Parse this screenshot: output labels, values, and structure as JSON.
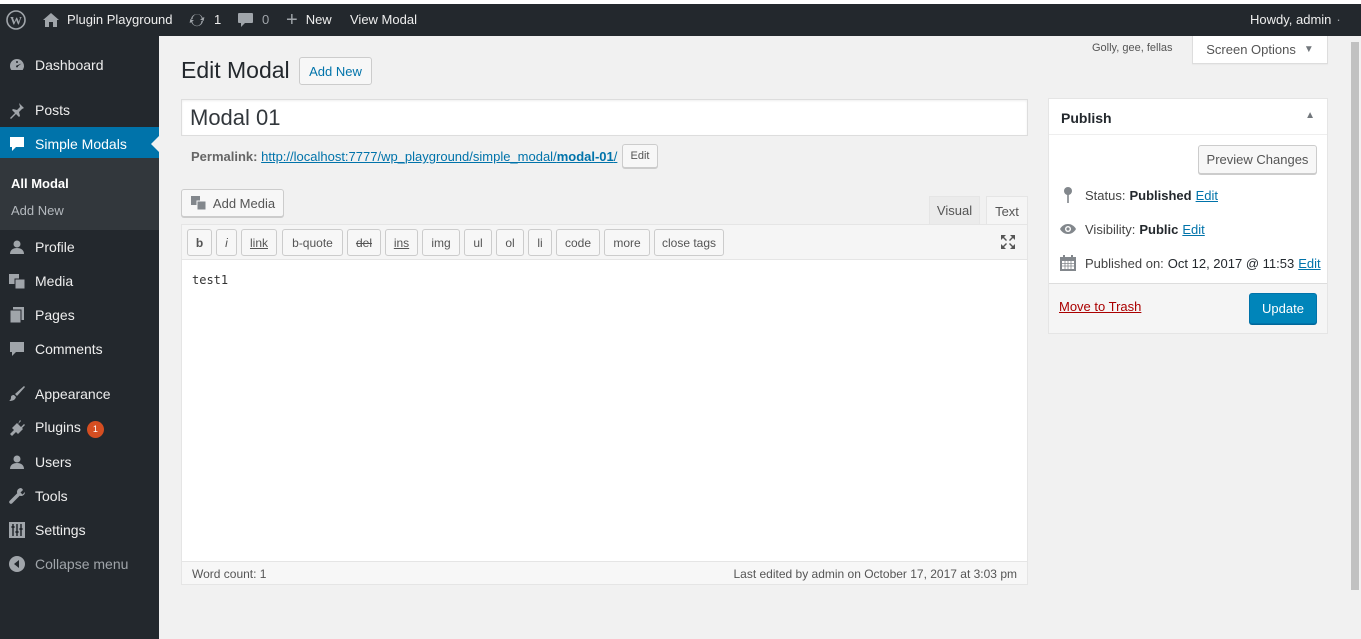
{
  "adminbar": {
    "site_name": "Plugin Playground",
    "updates_count": "1",
    "comments_count": "0",
    "new_label": "New",
    "view_label": "View Modal",
    "howdy": "Howdy, admin"
  },
  "sidebar": {
    "items": [
      {
        "label": "Dashboard"
      },
      {
        "label": "Posts"
      },
      {
        "label": "Simple Modals"
      },
      {
        "label": "Profile"
      },
      {
        "label": "Media"
      },
      {
        "label": "Pages"
      },
      {
        "label": "Comments"
      },
      {
        "label": "Appearance"
      },
      {
        "label": "Plugins",
        "badge": "1"
      },
      {
        "label": "Users"
      },
      {
        "label": "Tools"
      },
      {
        "label": "Settings"
      },
      {
        "label": "Collapse menu"
      }
    ],
    "submenu": [
      {
        "label": "All Modal"
      },
      {
        "label": "Add New"
      }
    ]
  },
  "header": {
    "hello_dolly": "Golly, gee, fellas",
    "screen_options": "Screen Options",
    "title": "Edit Modal",
    "add_new": "Add New"
  },
  "post": {
    "title": "Modal 01",
    "permalink_label": "Permalink:",
    "permalink_base": "http://localhost:7777/wp_playground/simple_modal/",
    "permalink_slug": "modal-01",
    "permalink_end": "/",
    "edit_slug": "Edit",
    "content": "test1"
  },
  "editor": {
    "add_media": "Add Media",
    "tab_visual": "Visual",
    "tab_text": "Text",
    "quicktags": [
      "b",
      "i",
      "link",
      "b-quote",
      "del",
      "ins",
      "img",
      "ul",
      "ol",
      "li",
      "code",
      "more",
      "close tags"
    ],
    "word_count": "Word count: 1",
    "last_edited": "Last edited by admin on October 17, 2017 at 3:03 pm"
  },
  "publish": {
    "title": "Publish",
    "preview": "Preview Changes",
    "status_label": "Status:",
    "status_value": "Published",
    "visibility_label": "Visibility:",
    "visibility_value": "Public",
    "published_label": "Published on:",
    "published_value": "Oct 12, 2017 @ 11:53",
    "edit": "Edit",
    "trash": "Move to Trash",
    "update": "Update"
  },
  "colors": {
    "accent": "#0073aa",
    "sidebar": "#23282d",
    "badge": "#d54e21",
    "trash": "#a00"
  }
}
